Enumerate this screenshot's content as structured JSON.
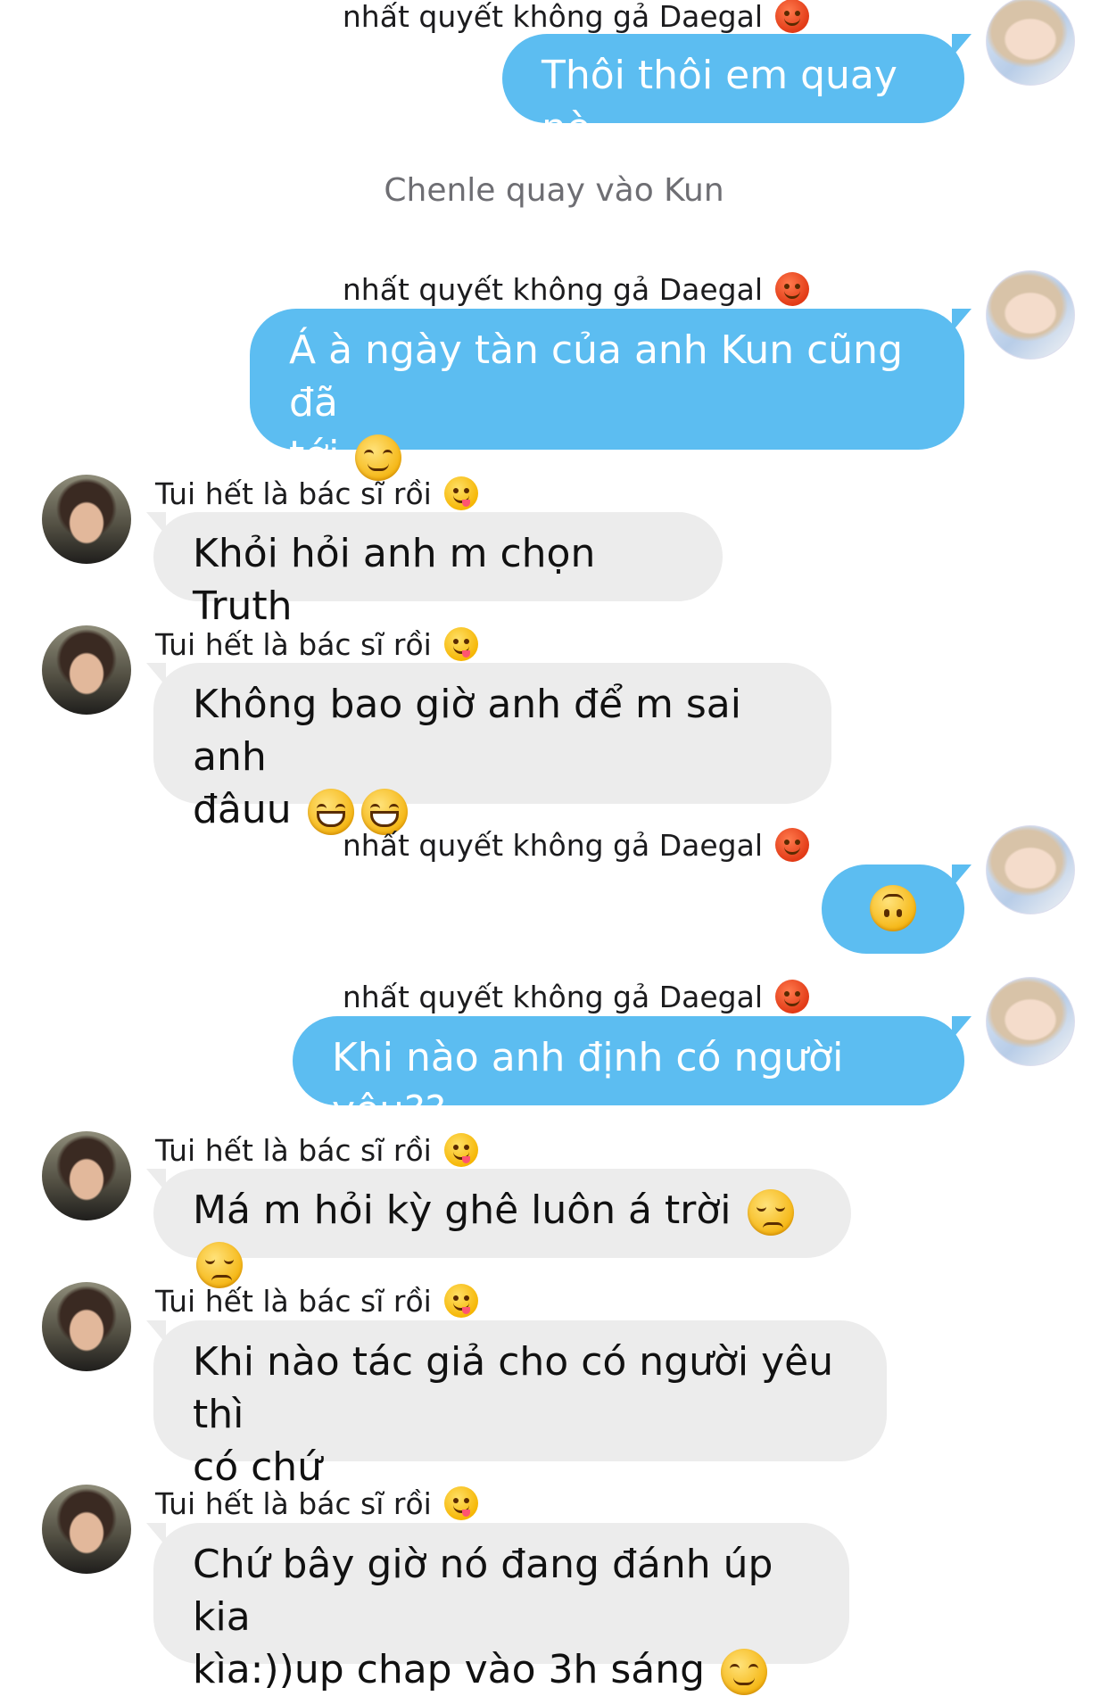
{
  "participants": {
    "me": {
      "name": "nhất quyết không gả Daegal",
      "name_emoji": "angry-face"
    },
    "other": {
      "name": "Tui hết là bác sĩ rồi",
      "name_emoji": "face-savoring-food"
    }
  },
  "colors": {
    "sent_bubble": "#5cbdf1",
    "received_bubble": "#ececec",
    "system_text": "#6e6e73"
  },
  "messages": [
    {
      "from": "me",
      "name": "nhất quyết không gả Daegal",
      "text": "Thôi thôi em quay nè",
      "emojis": []
    },
    {
      "type": "system",
      "text": "Chenle quay vào Kun"
    },
    {
      "from": "me",
      "name": "nhất quyết không gả Daegal",
      "text_line1": "Á à ngày tàn của anh Kun cũng đã",
      "text_line2": "tới",
      "emojis": [
        "relieved-face"
      ]
    },
    {
      "from": "other",
      "name": "Tui hết là bác sĩ rồi",
      "text": "Khỏi hỏi anh m chọn Truth",
      "emojis": []
    },
    {
      "from": "other",
      "name": "Tui hết là bác sĩ rồi",
      "text_line1": "Không bao giờ anh để m sai anh",
      "text_line2": "đâuu",
      "emojis": [
        "grinning-face",
        "grinning-face"
      ]
    },
    {
      "from": "me",
      "name": "nhất quyết không gả Daegal",
      "text": "",
      "emojis": [
        "upside-down-face"
      ]
    },
    {
      "from": "me",
      "name": "nhất quyết không gả Daegal",
      "text": "Khi nào anh định có người yêu??",
      "emojis": []
    },
    {
      "from": "other",
      "name": "Tui hết là bác sĩ rồi",
      "text": "Má m hỏi kỳ ghê luôn á trời",
      "emojis": [
        "unamused-face",
        "unamused-face"
      ]
    },
    {
      "from": "other",
      "name": "Tui hết là bác sĩ rồi",
      "text_line1": "Khi nào tác giả cho có người yêu thì",
      "text_line2": "có chứ",
      "emojis": []
    },
    {
      "from": "other",
      "name": "Tui hết là bác sĩ rồi",
      "text_line1": "Chứ bây giờ nó đang đánh úp kia",
      "text_line2": "kìa:))up chap vào 3h sáng",
      "emojis": [
        "relieved-face"
      ]
    }
  ]
}
